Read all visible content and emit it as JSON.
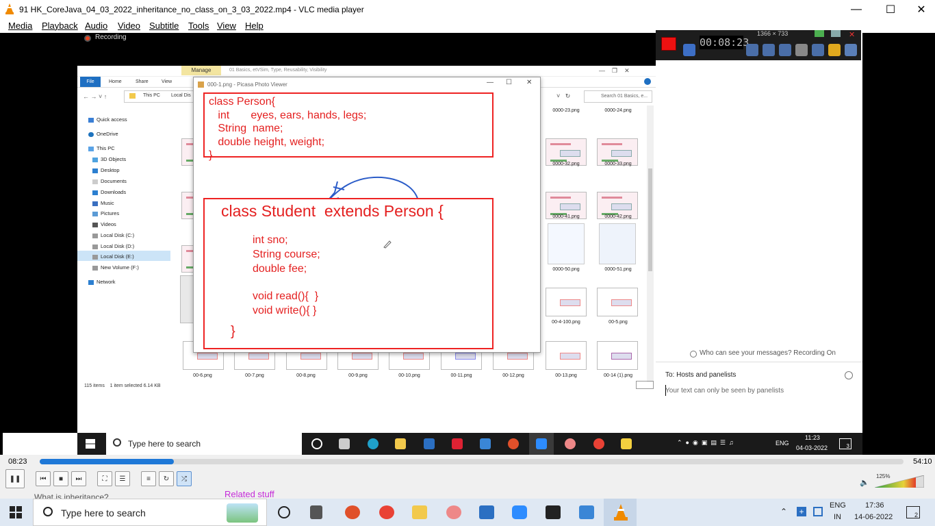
{
  "window": {
    "title": "91 HK_CoreJava_04_03_2022_inheritance_no_class_on_3_03_2022.mp4 - VLC media player"
  },
  "menu": [
    "Media",
    "Playback",
    "Audio",
    "Video",
    "Subtitle",
    "Tools",
    "View",
    "Help"
  ],
  "recording": {
    "label": "Recording"
  },
  "explorer": {
    "manage_tab": "Manage",
    "path_title": "01 Basics, etVSim, Type, Reusability, Visibility",
    "tabs": [
      "File",
      "Home",
      "Share",
      "View"
    ],
    "address": [
      "This PC",
      "Local Dis"
    ],
    "search_placeholder": "Search 01 Basics, e...",
    "nav": [
      "Quick access",
      "OneDrive",
      "This PC",
      "3D Objects",
      "Desktop",
      "Documents",
      "Downloads",
      "Music",
      "Pictures",
      "Videos",
      "Local Disk (C:)",
      "Local Disk (D:)",
      "Local Disk (E:)",
      "New Volume (F:)",
      "Network"
    ],
    "files_right": [
      "0000-23.png",
      "0000-24.png",
      "0000-32.png",
      "0000-33.png",
      "0000-41.png",
      "0000-42.png",
      "0000-50.png",
      "0000-51.png",
      "00-4-100.png",
      "00-5.png"
    ],
    "files_bottom": [
      "00-6.png",
      "00-7.png",
      "00-8.png",
      "00-9.png",
      "00-10.png",
      "00-11.png",
      "00-12.png",
      "00-13.png",
      "00-14 (1).png"
    ],
    "status_items": "115 items",
    "status_selected": "1 item selected  6.14 KB"
  },
  "picasa": {
    "title": "000-1.png - Picasa Photo Viewer",
    "box1": [
      "class Person{",
      "   int       eyes, ears, hands, legs;",
      "   String  name;",
      "   double height, weight;",
      "}"
    ],
    "box2_head": "class Student  extends Person {",
    "box2_body": [
      "int sno;",
      "String course;",
      "double fee;",
      "",
      "void read(){  }",
      "void write(){ }"
    ],
    "box2_close": "}"
  },
  "recorder": {
    "timer": "00:08:23",
    "resolution": "1366 × 733"
  },
  "chat": {
    "who": "Who can see your messages? Recording On",
    "to": "To:  Hosts and panelists",
    "placeholder": "Your text can only be seen by panelists"
  },
  "inner_taskbar": {
    "search": "Type here to search",
    "lang": "ENG",
    "time": "11:23",
    "date": "04-03-2022",
    "notif": "3"
  },
  "player": {
    "elapsed": "08:23",
    "total": "54:10",
    "progress": 0.155,
    "volume": "125%"
  },
  "host_taskbar": {
    "search": "Type here to search",
    "related": "Related stuff",
    "peek": "What is inheritance?",
    "lang1": "ENG",
    "lang2": "IN",
    "time": "17:36",
    "date": "14-06-2022",
    "notif": "2"
  }
}
